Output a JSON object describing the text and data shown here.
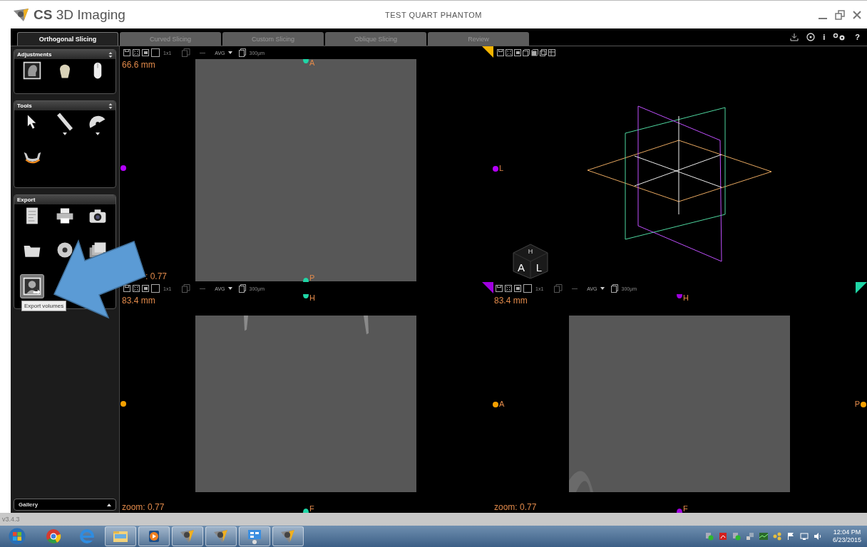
{
  "window": {
    "app_name": "**CS** 3D Imaging",
    "title": "TEST QUART PHANTOM"
  },
  "tabs": [
    {
      "label": "Orthogonal Slicing",
      "selected": true
    },
    {
      "label": "Curved Slicing",
      "selected": false
    },
    {
      "label": "Custom Slicing",
      "selected": false
    },
    {
      "label": "Oblique Slicing",
      "selected": false
    },
    {
      "label": "Review",
      "selected": false
    }
  ],
  "header_actions": [
    {
      "kind": "export"
    },
    {
      "kind": "target"
    },
    {
      "kind": "info",
      "label": "i"
    },
    {
      "kind": "settings"
    },
    {
      "kind": "help",
      "label": "?"
    }
  ],
  "sidebar": {
    "panels": [
      {
        "title": "Adjustments",
        "collapsible": true,
        "tools": [
          {
            "kind": "xray",
            "dropdown": false,
            "selected": false
          },
          {
            "kind": "skull",
            "dropdown": false,
            "selected": false
          },
          {
            "kind": "mouse",
            "dropdown": false,
            "selected": false
          }
        ]
      },
      {
        "title": "Tools",
        "collapsible": true,
        "tools": [
          {
            "kind": "pointer",
            "dropdown": false,
            "selected": false
          },
          {
            "kind": "ruler",
            "dropdown": true,
            "selected": false
          },
          {
            "kind": "protractor",
            "dropdown": true,
            "selected": false
          },
          {
            "kind": "jaw",
            "dropdown": false,
            "selected": false
          }
        ]
      },
      {
        "title": "Export",
        "collapsible": false,
        "tools": [
          {
            "kind": "report",
            "dropdown": false,
            "selected": false
          },
          {
            "kind": "printer",
            "dropdown": false,
            "selected": false
          },
          {
            "kind": "camera",
            "dropdown": false,
            "selected": false
          },
          {
            "kind": "folder",
            "dropdown": false,
            "selected": false
          },
          {
            "kind": "disc",
            "dropdown": false,
            "selected": false
          },
          {
            "kind": "stack",
            "dropdown": false,
            "selected": false
          },
          {
            "kind": "volume",
            "dropdown": false,
            "selected": true,
            "tooltip": "Export volumes"
          }
        ]
      }
    ],
    "gallery": "Gallery",
    "version": "v3.4.3"
  },
  "viewports": [
    {
      "kind": "slice",
      "toolbar": {
        "layout": "1x1",
        "filter": "AVG",
        "thickness": "300µm"
      },
      "distance": "66.6 mm",
      "zoom": ": 0.77",
      "markers": [
        {
          "kind": "top",
          "label": "A",
          "color": "#1fd6a6"
        },
        {
          "kind": "bottom",
          "label": "P",
          "color": "#1fd6a6"
        },
        {
          "kind": "left",
          "color": "#b400ff"
        }
      ]
    },
    {
      "kind": "volume",
      "corners": [
        {
          "kind": "left",
          "color": "#f5b400"
        }
      ],
      "markers": [
        {
          "kind": "left",
          "label": "L",
          "color": "#b400ff"
        }
      ],
      "cube": {
        "top": "H",
        "left": "A",
        "right": "L"
      }
    },
    {
      "kind": "slice",
      "toolbar": {
        "layout": "1x1",
        "filter": "AVG",
        "thickness": "300µm"
      },
      "distance": "83.4 mm",
      "zoom": "zoom: 0.77",
      "markers": [
        {
          "kind": "top",
          "label": "H",
          "color": "#1fd6a6"
        },
        {
          "kind": "bottom",
          "label": "F",
          "color": "#1fd6a6"
        },
        {
          "kind": "left",
          "color": "#f5a000"
        }
      ]
    },
    {
      "kind": "slice",
      "corners": [
        {
          "kind": "left",
          "color": "#a000e0"
        },
        {
          "kind": "right",
          "color": "#1fd6a6"
        }
      ],
      "toolbar": {
        "layout": "1x1",
        "filter": "AVG",
        "thickness": "300µm"
      },
      "distance": "83.4 mm",
      "zoom": "zoom: 0.77",
      "markers": [
        {
          "kind": "top",
          "label": "H",
          "color": "#a000e0"
        },
        {
          "kind": "bottom",
          "label": "F",
          "color": "#a000e0"
        },
        {
          "kind": "left",
          "label": "A",
          "color": "#f5a000"
        },
        {
          "kind": "right",
          "label": "P",
          "color": "#f5a000"
        }
      ]
    }
  ],
  "taskbar": {
    "apps": [
      {
        "kind": "start",
        "open": false
      },
      {
        "kind": "chrome",
        "open": false
      },
      {
        "kind": "ie",
        "open": false
      },
      {
        "kind": "explorer",
        "open": true
      },
      {
        "kind": "media",
        "open": true
      },
      {
        "kind": "cs3d",
        "open": true
      },
      {
        "kind": "cs3d",
        "open": true
      },
      {
        "kind": "remote",
        "open": true
      },
      {
        "kind": "cs3d",
        "open": true
      }
    ],
    "tray": [
      {
        "kind": "check"
      },
      {
        "kind": "pdf"
      },
      {
        "kind": "check"
      },
      {
        "kind": "network"
      },
      {
        "kind": "graph"
      },
      {
        "kind": "hub"
      },
      {
        "kind": "flag"
      },
      {
        "kind": "monitor"
      },
      {
        "kind": "speaker"
      }
    ],
    "time": "12:04 PM",
    "date": "6/23/2015"
  }
}
